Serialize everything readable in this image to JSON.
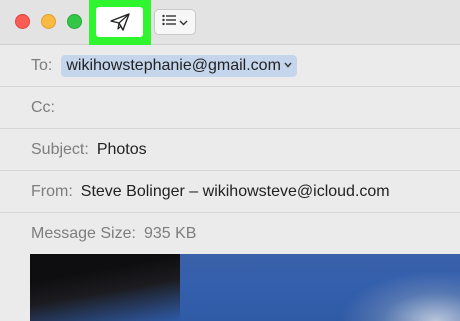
{
  "window": {
    "send_icon": "paper-plane-icon",
    "format_icon": "list-icon"
  },
  "headers": {
    "to": {
      "label": "To:",
      "value": "wikihowstephanie@gmail.com"
    },
    "cc": {
      "label": "Cc:",
      "value": ""
    },
    "subject": {
      "label": "Subject:",
      "value": "Photos"
    },
    "from": {
      "label": "From:",
      "value": "Steve Bolinger – wikihowsteve@icloud.com"
    },
    "message_size": {
      "label": "Message Size:",
      "value": "935 KB"
    }
  },
  "colors": {
    "highlight": "#2ef52e",
    "token": "#c5d6ec",
    "close": "#fd5c55",
    "minimize": "#f9b942",
    "maximize": "#33c748"
  }
}
